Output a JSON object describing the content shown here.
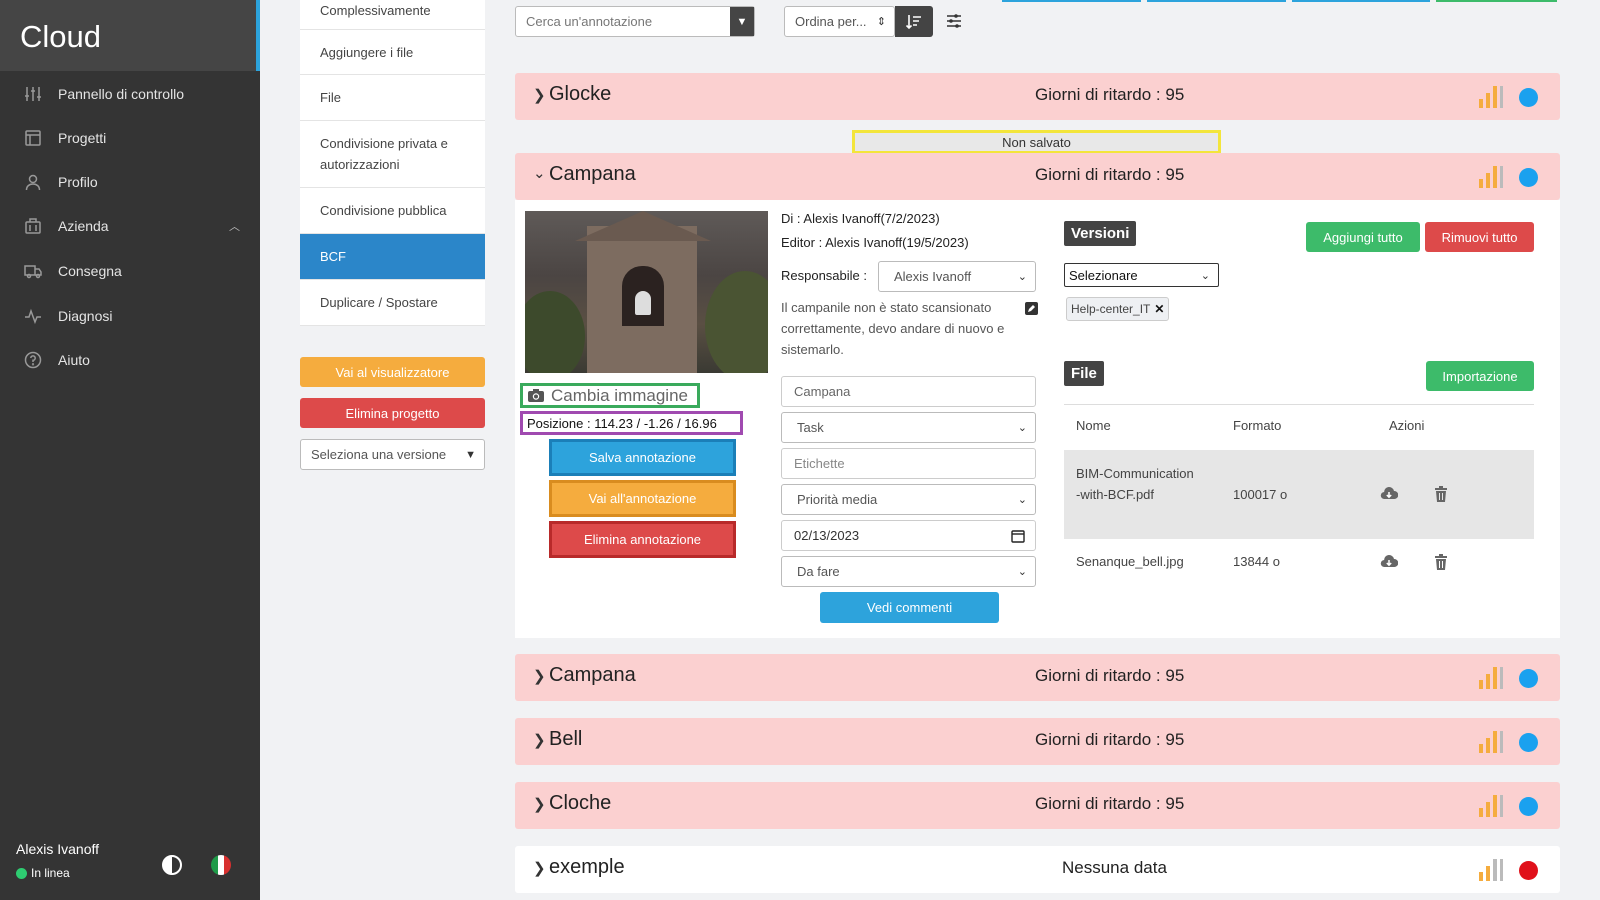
{
  "sidebar": {
    "brand": "Cloud",
    "items": [
      {
        "label": "Pannello di controllo",
        "icon": "sliders-icon"
      },
      {
        "label": "Progetti",
        "icon": "layout-icon"
      },
      {
        "label": "Profilo",
        "icon": "user-icon"
      },
      {
        "label": "Azienda",
        "icon": "building-icon"
      },
      {
        "label": "Consegna",
        "icon": "truck-icon"
      },
      {
        "label": "Diagnosi",
        "icon": "pulse-icon"
      },
      {
        "label": "Aiuto",
        "icon": "help-icon"
      }
    ],
    "user_name": "Alexis Ivanoff",
    "user_status": "In linea"
  },
  "menu": {
    "items": [
      "Complessivamente",
      "Aggiungere i file",
      "File",
      "Condivisione privata e autorizzazioni",
      "Condivisione pubblica",
      "BCF",
      "Duplicare / Spostare"
    ],
    "active": "BCF",
    "viewer_button": "Vai al visualizzatore",
    "delete_project_button": "Elimina progetto",
    "version_select": "Seleziona una versione"
  },
  "toolbar": {
    "search_placeholder": "Cerca un'annotazione",
    "sort_label": "Ordina per..."
  },
  "topics": [
    {
      "title": "Glocke",
      "delay": "Giorni di ritardo : 95",
      "status_color": "#1aa1ef",
      "expanded": false
    },
    {
      "title": "Campana",
      "delay": "Giorni di ritardo : 95",
      "status_color": "#1aa1ef",
      "expanded": true
    },
    {
      "title": "Campana",
      "delay": "Giorni di ritardo : 95",
      "status_color": "#1aa1ef",
      "expanded": false
    },
    {
      "title": "Bell",
      "delay": "Giorni di ritardo : 95",
      "status_color": "#1aa1ef",
      "expanded": false
    },
    {
      "title": "Cloche",
      "delay": "Giorni di ritardo : 95",
      "status_color": "#1aa1ef",
      "expanded": false
    },
    {
      "title": "exemple",
      "delay": "Nessuna data",
      "status_color": "#e0101a",
      "expanded": false
    }
  ],
  "unsaved_label": "Non salvato",
  "detail": {
    "change_image": "Cambia immagine",
    "position": "Posizione : 114.23 / -1.26 / 16.96",
    "save_button": "Salva annotazione",
    "goto_button": "Vai all'annotazione",
    "delete_button": "Elimina annotazione",
    "author": "Di : Alexis Ivanoff(7/2/2023)",
    "editor": "Editor : Alexis Ivanoff(19/5/2023)",
    "assignee_label": "Responsabile :",
    "assignee_value": "Alexis Ivanoff",
    "description": "Il campanile non è stato scansionato correttamente, devo andare di nuovo e sistemarlo.",
    "title_placeholder": "Campana",
    "type_value": "Task",
    "labels_placeholder": "Etichette",
    "priority_value": "Priorità media",
    "due_date": "02/13/2023",
    "status_value": "Da fare",
    "comments_button": "Vedi commenti"
  },
  "versions": {
    "header": "Versioni",
    "add_all": "Aggiungi tutto",
    "remove_all": "Rimuovi tutto",
    "select_value": "Selezionare",
    "tag": "Help-center_IT"
  },
  "files": {
    "header": "File",
    "import_button": "Importazione",
    "columns": [
      "Nome",
      "Formato",
      "Azioni"
    ],
    "rows": [
      {
        "name": "BIM-Communication-with-BCF.pdf",
        "size": "100017 o"
      },
      {
        "name": "Senanque_bell.jpg",
        "size": "13844 o"
      }
    ]
  },
  "colors": {
    "sidebar_bg": "#343434",
    "accent_blue": "#2ca3dc",
    "section_pink": "#fbd0d0",
    "orange": "#f5ac3e",
    "red": "#dd4a4a",
    "green": "#3dbb6a"
  }
}
